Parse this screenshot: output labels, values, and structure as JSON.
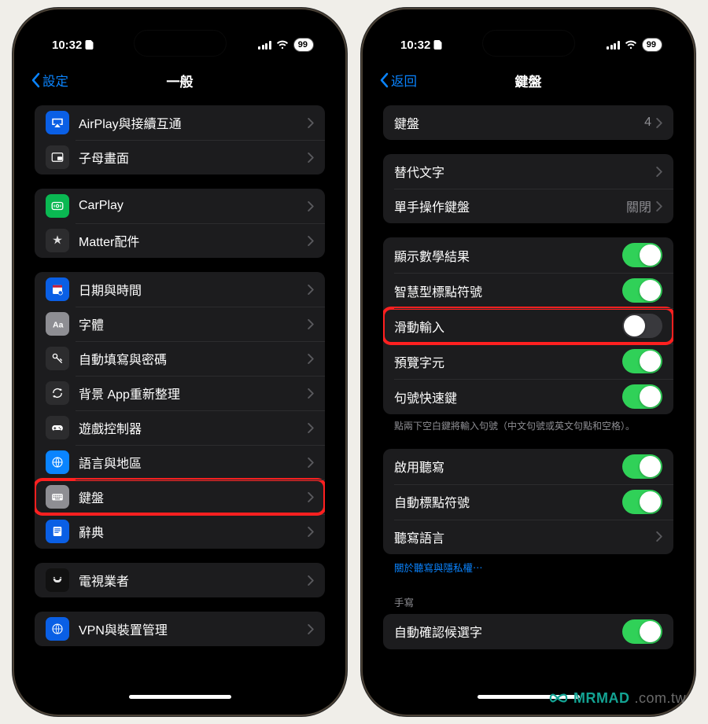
{
  "status": {
    "time": "10:32",
    "battery": "99"
  },
  "left": {
    "back": "設定",
    "title": "一般",
    "g1": [
      {
        "icon": "airplay",
        "bg": "bg-blue",
        "label": "AirPlay與接續互通"
      },
      {
        "icon": "pip",
        "bg": "bg-dark",
        "label": "子母畫面"
      }
    ],
    "g2": [
      {
        "icon": "carplay",
        "bg": "bg-green",
        "label": "CarPlay"
      },
      {
        "icon": "matter",
        "bg": "bg-dark",
        "label": "Matter配件"
      }
    ],
    "g3": [
      {
        "icon": "calendar",
        "bg": "bg-blue",
        "label": "日期與時間"
      },
      {
        "icon": "font",
        "bg": "bg-grey",
        "label": "字體"
      },
      {
        "icon": "key",
        "bg": "bg-key",
        "label": "自動填寫與密碼"
      },
      {
        "icon": "refresh",
        "bg": "bg-dark",
        "label": "背景 App重新整理"
      },
      {
        "icon": "gamepad",
        "bg": "bg-dark",
        "label": "遊戲控制器"
      },
      {
        "icon": "globe",
        "bg": "bg-globe",
        "label": "語言與地區"
      },
      {
        "icon": "keyboard",
        "bg": "bg-grey",
        "label": "鍵盤",
        "hl": true
      },
      {
        "icon": "book",
        "bg": "bg-book",
        "label": "辭典"
      }
    ],
    "g4": [
      {
        "icon": "tv",
        "bg": "bg-black",
        "label": "電視業者"
      }
    ],
    "g5": [
      {
        "icon": "vpn",
        "bg": "bg-blue",
        "label": "VPN與裝置管理"
      }
    ]
  },
  "right": {
    "back": "返回",
    "title": "鍵盤",
    "g1": [
      {
        "label": "鍵盤",
        "value": "4"
      }
    ],
    "g2": [
      {
        "label": "替代文字"
      },
      {
        "label": "單手操作鍵盤",
        "value": "關閉"
      }
    ],
    "g3": [
      {
        "label": "顯示數學結果",
        "toggle": "on"
      },
      {
        "label": "智慧型標點符號",
        "toggle": "on"
      },
      {
        "label": "滑動輸入",
        "toggle": "off",
        "hl": true
      },
      {
        "label": "預覽字元",
        "toggle": "on"
      },
      {
        "label": "句號快速鍵",
        "toggle": "on"
      }
    ],
    "g3_footer": "點兩下空白鍵將輸入句號（中文句號或英文句點和空格）。",
    "g4": [
      {
        "label": "啟用聽寫",
        "toggle": "on"
      },
      {
        "label": "自動標點符號",
        "toggle": "on"
      },
      {
        "label": "聽寫語言"
      }
    ],
    "g4_link": "關於聽寫與隱私權⋯",
    "g5_header": "手寫",
    "g5": [
      {
        "label": "自動確認候選字",
        "toggle": "on"
      }
    ]
  },
  "watermark": {
    "brand": "MRMAD",
    "suffix": ".com.tw"
  }
}
